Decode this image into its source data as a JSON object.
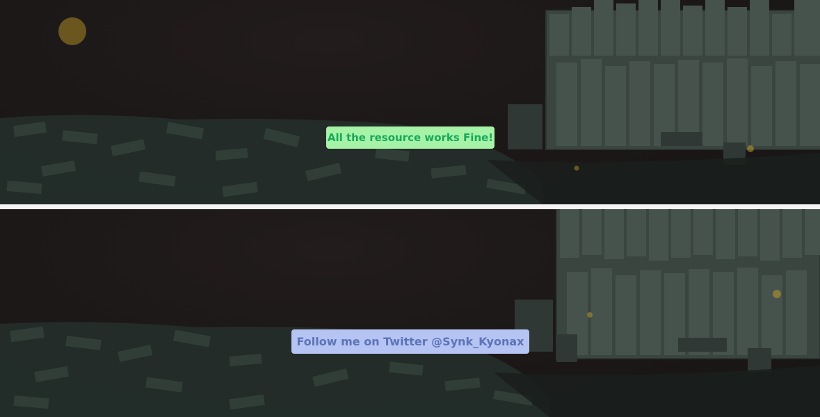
{
  "notifications": {
    "success_text": "All the resource works Fine!",
    "info_text": "Follow me on Twitter @Synk_Kyonax"
  },
  "colors": {
    "background": "#1a1616",
    "divider": "#f4f4f4",
    "success_bg": "#a6f3a8",
    "success_text": "#19a85a",
    "info_bg": "#b6c4f3",
    "info_text": "#5b74b8",
    "coin": "#c9a227"
  }
}
